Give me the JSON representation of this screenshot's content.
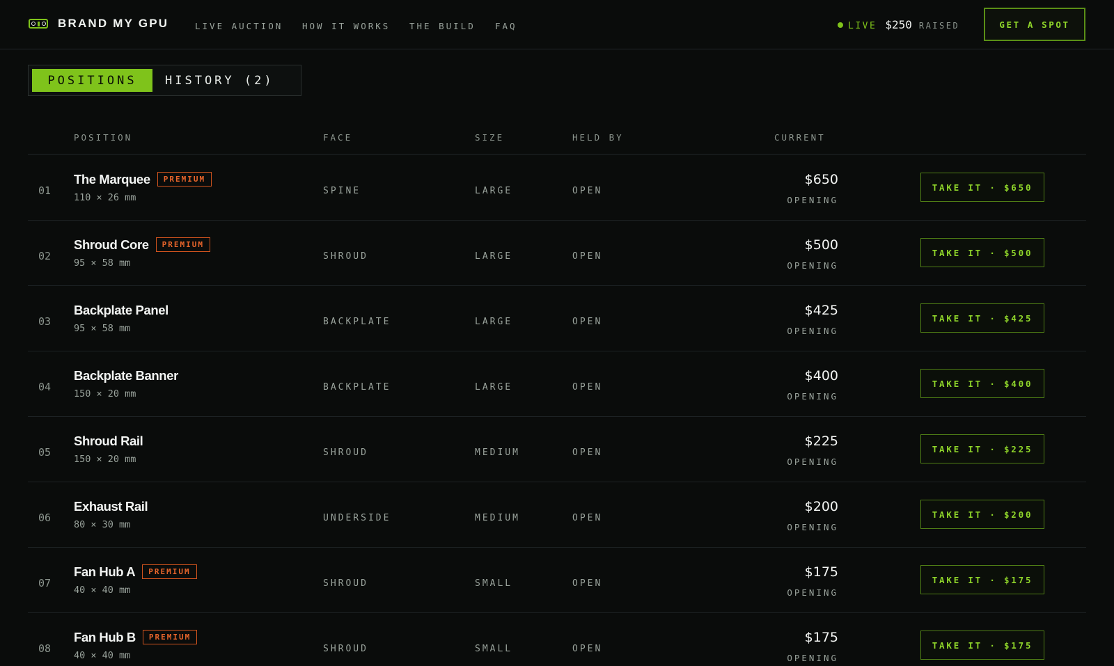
{
  "header": {
    "brand": "BRAND MY GPU",
    "nav": [
      "LIVE AUCTION",
      "HOW IT WORKS",
      "THE BUILD",
      "FAQ"
    ],
    "live_label": "LIVE",
    "raised_amount": "$250",
    "raised_label": "RAISED",
    "cta": "GET A SPOT"
  },
  "tabs": {
    "active": "POSITIONS",
    "inactive": "HISTORY (2)"
  },
  "table": {
    "columns": [
      "POSITION",
      "FACE",
      "SIZE",
      "HELD BY",
      "CURRENT"
    ],
    "rows": [
      {
        "num": "01",
        "name": "The Marquee",
        "badge": "PREMIUM",
        "dims": "110 × 26 mm",
        "face": "SPINE",
        "size": "LARGE",
        "held_by": "OPEN",
        "price": "$650",
        "price_note": "OPENING",
        "action": "TAKE IT · $650"
      },
      {
        "num": "02",
        "name": "Shroud Core",
        "badge": "PREMIUM",
        "dims": "95 × 58 mm",
        "face": "SHROUD",
        "size": "LARGE",
        "held_by": "OPEN",
        "price": "$500",
        "price_note": "OPENING",
        "action": "TAKE IT · $500"
      },
      {
        "num": "03",
        "name": "Backplate Panel",
        "badge": "",
        "dims": "95 × 58 mm",
        "face": "BACKPLATE",
        "size": "LARGE",
        "held_by": "OPEN",
        "price": "$425",
        "price_note": "OPENING",
        "action": "TAKE IT · $425"
      },
      {
        "num": "04",
        "name": "Backplate Banner",
        "badge": "",
        "dims": "150 × 20 mm",
        "face": "BACKPLATE",
        "size": "LARGE",
        "held_by": "OPEN",
        "price": "$400",
        "price_note": "OPENING",
        "action": "TAKE IT · $400"
      },
      {
        "num": "05",
        "name": "Shroud Rail",
        "badge": "",
        "dims": "150 × 20 mm",
        "face": "SHROUD",
        "size": "MEDIUM",
        "held_by": "OPEN",
        "price": "$225",
        "price_note": "OPENING",
        "action": "TAKE IT · $225"
      },
      {
        "num": "06",
        "name": "Exhaust Rail",
        "badge": "",
        "dims": "80 × 30 mm",
        "face": "UNDERSIDE",
        "size": "MEDIUM",
        "held_by": "OPEN",
        "price": "$200",
        "price_note": "OPENING",
        "action": "TAKE IT · $200"
      },
      {
        "num": "07",
        "name": "Fan Hub A",
        "badge": "PREMIUM",
        "dims": "40 × 40 mm",
        "face": "SHROUD",
        "size": "SMALL",
        "held_by": "OPEN",
        "price": "$175",
        "price_note": "OPENING",
        "action": "TAKE IT · $175"
      },
      {
        "num": "08",
        "name": "Fan Hub B",
        "badge": "PREMIUM",
        "dims": "40 × 40 mm",
        "face": "SHROUD",
        "size": "SMALL",
        "held_by": "OPEN",
        "price": "$175",
        "price_note": "OPENING",
        "action": "TAKE IT · $175"
      }
    ]
  },
  "colors": {
    "background": "#0a0c0b",
    "accent": "#7fc31b",
    "premium": "#e8652b"
  }
}
